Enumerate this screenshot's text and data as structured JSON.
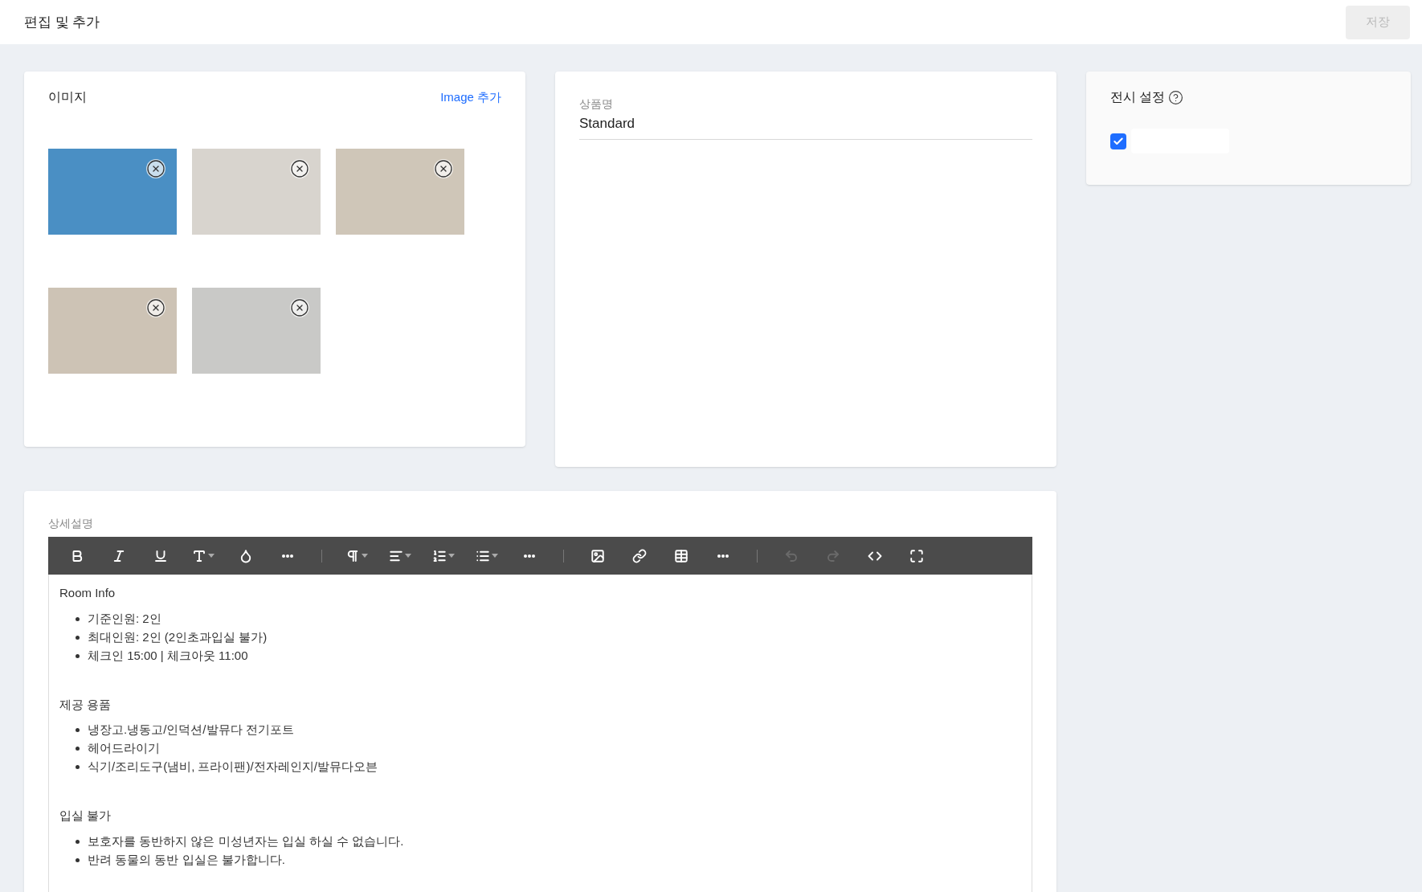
{
  "header": {
    "title": "편집 및 추가",
    "save_button": {
      "label": "저장",
      "disabled": true
    }
  },
  "image_card": {
    "title": "이미지",
    "add_link": "Image 추가",
    "images": [
      {
        "kind": "photo"
      },
      {
        "kind": "photo"
      },
      {
        "kind": "photo"
      },
      {
        "kind": "photo"
      },
      {
        "kind": "photo"
      }
    ]
  },
  "product_card": {
    "label": "상품명",
    "value": "Standard"
  },
  "display_card": {
    "title": "전시 설정",
    "checkbox": {
      "checked": true
    }
  },
  "editor": {
    "label": "상세설명",
    "toolbar": [
      {
        "kind": "button",
        "caret": false,
        "disabled": false
      },
      {
        "kind": "button",
        "caret": false,
        "disabled": false
      },
      {
        "kind": "button",
        "caret": false,
        "disabled": false
      },
      {
        "kind": "button",
        "caret": true,
        "disabled": false
      },
      {
        "kind": "button",
        "caret": false,
        "disabled": false
      },
      {
        "kind": "button",
        "caret": false,
        "disabled": false
      },
      {
        "kind": "separator"
      },
      {
        "kind": "button",
        "caret": true,
        "disabled": false
      },
      {
        "kind": "button",
        "caret": true,
        "disabled": false
      },
      {
        "kind": "button",
        "caret": true,
        "disabled": false
      },
      {
        "kind": "button",
        "caret": true,
        "disabled": false
      },
      {
        "kind": "button",
        "caret": false,
        "disabled": false
      },
      {
        "kind": "separator"
      },
      {
        "kind": "button",
        "caret": false,
        "disabled": false
      },
      {
        "kind": "button",
        "caret": false,
        "disabled": false
      },
      {
        "kind": "button",
        "caret": false,
        "disabled": false
      },
      {
        "kind": "button",
        "caret": false,
        "disabled": false
      },
      {
        "kind": "separator"
      },
      {
        "kind": "button",
        "caret": false,
        "disabled": true
      },
      {
        "kind": "button",
        "caret": false,
        "disabled": true
      },
      {
        "kind": "button",
        "caret": false,
        "disabled": false
      },
      {
        "kind": "button",
        "caret": false,
        "disabled": false
      }
    ],
    "sections": [
      {
        "heading": "Room Info",
        "items": [
          "기준인원: 2인",
          "최대인원: 2인 (2인초과입실 불가)",
          "체크인 15:00 | 체크아웃 11:00"
        ]
      },
      {
        "heading": "제공 용품",
        "items": [
          "냉장고.냉동고/인덕션/발뮤다 전기포트",
          "헤어드라이기",
          "식기/조리도구(냄비, 프라이팬)/전자레인지/발뮤다오븐"
        ]
      },
      {
        "heading": "입실 불가",
        "items": [
          "보호자를 동반하지 않은 미성년자는 입실 하실 수 없습니다.",
          "반려 동물의 동반 입실은 불가합니다."
        ]
      }
    ]
  }
}
